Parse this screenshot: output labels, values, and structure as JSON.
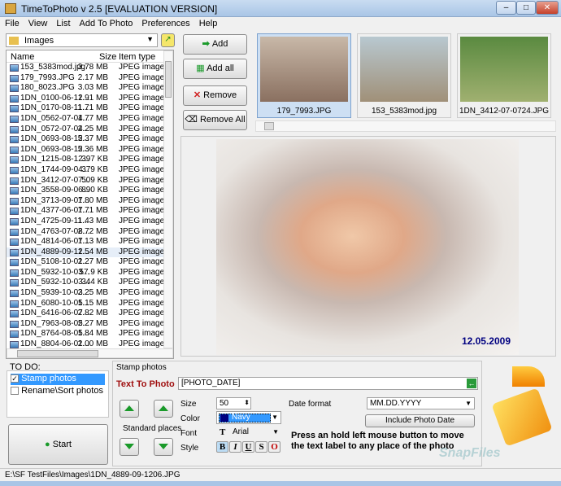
{
  "window": {
    "title": "TimeToPhoto v 2.5 [EVALUATION VERSION]",
    "minimize": "–",
    "maximize": "□",
    "close": "✕"
  },
  "menu": [
    "File",
    "View",
    "List",
    "Add To Photo",
    "Preferences",
    "Help"
  ],
  "folder": {
    "value": "Images"
  },
  "list": {
    "headers": {
      "name": "Name",
      "size": "Size",
      "type": "Item type"
    },
    "rows": [
      [
        "153_5383mod.jpg",
        "3.78 MB",
        "JPEG image"
      ],
      [
        "179_7993.JPG",
        "2.17 MB",
        "JPEG image"
      ],
      [
        "180_8023.JPG",
        "3.03 MB",
        "JPEG image"
      ],
      [
        "1DN_0100-06-12...",
        "1.91 MB",
        "JPEG image"
      ],
      [
        "1DN_0170-08-11...",
        "1.71 MB",
        "JPEG image"
      ],
      [
        "1DN_0562-07-04...",
        "1.77 MB",
        "JPEG image"
      ],
      [
        "1DN_0572-07-04...",
        "2.25 MB",
        "JPEG image"
      ],
      [
        "1DN_0693-08-12...",
        "5.37 MB",
        "JPEG image"
      ],
      [
        "1DN_0693-08-12...",
        "5.36 MB",
        "JPEG image"
      ],
      [
        "1DN_1215-08-12...",
        "397 KB",
        "JPEG image"
      ],
      [
        "1DN_1744-09-04...",
        "379 KB",
        "JPEG image"
      ],
      [
        "1DN_3412-07-07...",
        "509 KB",
        "JPEG image"
      ],
      [
        "1DN_3558-09-06...",
        "890 KB",
        "JPEG image"
      ],
      [
        "1DN_3713-09-07...",
        "1.80 MB",
        "JPEG image"
      ],
      [
        "1DN_4377-06-07...",
        "1.71 MB",
        "JPEG image"
      ],
      [
        "1DN_4725-09-11...",
        "1.43 MB",
        "JPEG image"
      ],
      [
        "1DN_4763-07-08...",
        "2.72 MB",
        "JPEG image"
      ],
      [
        "1DN_4814-06-07...",
        "1.13 MB",
        "JPEG image"
      ],
      [
        "1DN_4889-09-12...",
        "1.54 MB",
        "JPEG image"
      ],
      [
        "1DN_5108-10-01...",
        "2.27 MB",
        "JPEG image"
      ],
      [
        "1DN_5932-10-03...",
        "57.9 KB",
        "JPEG image"
      ],
      [
        "1DN_5932-10-03...",
        "344 KB",
        "JPEG image"
      ],
      [
        "1DN_5939-10-03...",
        "2.25 MB",
        "JPEG image"
      ],
      [
        "1DN_6080-10-05...",
        "1.15 MB",
        "JPEG image"
      ],
      [
        "1DN_6416-06-07...",
        "2.82 MB",
        "JPEG image"
      ],
      [
        "1DN_7963-08-05...",
        "2.27 MB",
        "JPEG image"
      ],
      [
        "1DN_8764-08-05...",
        "1.84 MB",
        "JPEG image"
      ],
      [
        "1DN_8804-06-01...",
        "2.00 MB",
        "JPEG image"
      ]
    ],
    "selected_index": 18
  },
  "buttons": {
    "add": "Add",
    "add_all": "Add all",
    "remove": "Remove",
    "remove_all": "Remove All",
    "start": "Start"
  },
  "thumbnails": [
    {
      "label": "179_7993.JPG",
      "selected": true
    },
    {
      "label": "153_5383mod.jpg",
      "selected": false
    },
    {
      "label": "1DN_3412-07-0724.JPG",
      "selected": false
    }
  ],
  "preview": {
    "stamp_text": "12.05.2009",
    "stamp_color": "#000080"
  },
  "todo": {
    "title": "TO DO:",
    "items": [
      {
        "label": "Stamp photos",
        "checked": true
      },
      {
        "label": "Rename\\Sort photos",
        "checked": false
      }
    ]
  },
  "stamp": {
    "title": "Stamp photos",
    "text_label": "Text To Photo",
    "text_value": "[PHOTO_DATE]",
    "standard_places": "Standard places",
    "size_label": "Size",
    "size_value": "50",
    "color_label": "Color",
    "color_value": "Navy",
    "font_label": "Font",
    "font_value": "Arial",
    "style_label": "Style",
    "styles": [
      "B",
      "I",
      "U",
      "S",
      "O"
    ],
    "date_format_label": "Date format",
    "date_format_value": "MM.DD.YYYY",
    "include_date": "Include Photo Date",
    "hint": "Press an hold left mouse button to move the text label to any place of the photo"
  },
  "status": {
    "path": "E:\\SF TestFiles\\Images\\1DN_4889-09-1206.JPG"
  },
  "watermark": "SnapFiles"
}
